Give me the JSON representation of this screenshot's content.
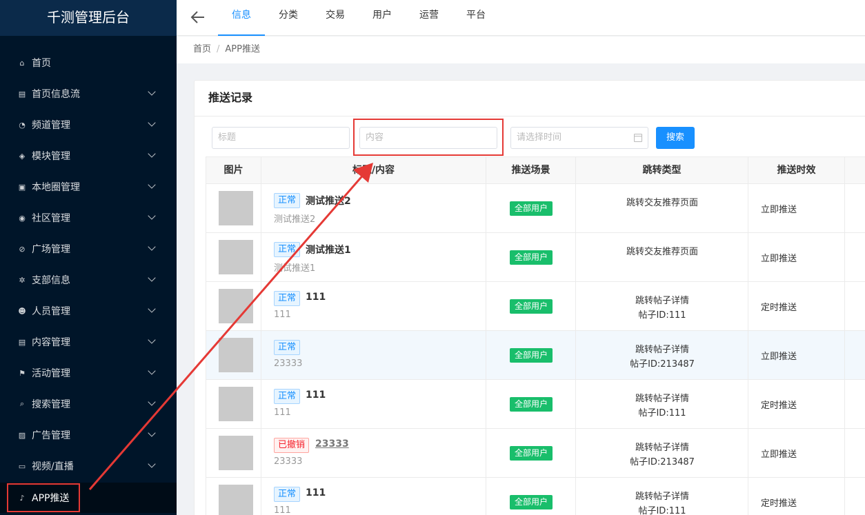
{
  "app": {
    "title": "千测管理后台"
  },
  "sidebar": {
    "items": [
      {
        "label": "首页",
        "icon": "home-icon",
        "glyph": "⌂",
        "has_arrow": false
      },
      {
        "label": "首页信息流",
        "icon": "list-icon",
        "glyph": "▤",
        "has_arrow": true
      },
      {
        "label": "频道管理",
        "icon": "rss-icon",
        "glyph": "◔",
        "has_arrow": true
      },
      {
        "label": "模块管理",
        "icon": "cube-icon",
        "glyph": "◈",
        "has_arrow": true
      },
      {
        "label": "本地圈管理",
        "icon": "location-icon",
        "glyph": "▣",
        "has_arrow": true
      },
      {
        "label": "社区管理",
        "icon": "community-icon",
        "glyph": "◉",
        "has_arrow": true
      },
      {
        "label": "广场管理",
        "icon": "compass-icon",
        "glyph": "⊘",
        "has_arrow": true
      },
      {
        "label": "支部信息",
        "icon": "settings-icon",
        "glyph": "✲",
        "has_arrow": true
      },
      {
        "label": "人员管理",
        "icon": "users-icon",
        "glyph": "☻",
        "has_arrow": true
      },
      {
        "label": "内容管理",
        "icon": "document-icon",
        "glyph": "▤",
        "has_arrow": true
      },
      {
        "label": "活动管理",
        "icon": "flag-icon",
        "glyph": "⚑",
        "has_arrow": true
      },
      {
        "label": "搜索管理",
        "icon": "search-icon",
        "glyph": "⌕",
        "has_arrow": true
      },
      {
        "label": "广告管理",
        "icon": "image-icon",
        "glyph": "▨",
        "has_arrow": true
      },
      {
        "label": "视频/直播",
        "icon": "video-icon",
        "glyph": "▭",
        "has_arrow": true
      },
      {
        "label": "APP推送",
        "icon": "bell-icon",
        "glyph": "♪",
        "has_arrow": false,
        "active": true
      }
    ]
  },
  "header": {
    "tabs": [
      {
        "label": "信息",
        "active": true
      },
      {
        "label": "分类"
      },
      {
        "label": "交易"
      },
      {
        "label": "用户"
      },
      {
        "label": "运营"
      },
      {
        "label": "平台"
      }
    ]
  },
  "breadcrumb": {
    "home": "首页",
    "current": "APP推送"
  },
  "card": {
    "title": "推送记录"
  },
  "filters": {
    "title_placeholder": "标题",
    "content_placeholder": "内容",
    "date_placeholder": "请选择时间",
    "search_label": "搜索"
  },
  "table": {
    "columns": [
      "图片",
      "标题/内容",
      "推送场景",
      "跳转类型",
      "推送时效"
    ],
    "rows": [
      {
        "status": "正常",
        "status_type": "ok",
        "title": "测试推送2",
        "content": "测试推送2",
        "scene": "全部用户",
        "jump": "跳转交友推荐页面",
        "jump_detail": "",
        "effect": "立即推送"
      },
      {
        "status": "正常",
        "status_type": "ok",
        "title": "测试推送1",
        "content": "测试推送1",
        "scene": "全部用户",
        "jump": "跳转交友推荐页面",
        "jump_detail": "",
        "effect": "立即推送"
      },
      {
        "status": "正常",
        "status_type": "ok",
        "title": "111",
        "content": "111",
        "scene": "全部用户",
        "jump": "跳转帖子详情",
        "jump_detail": "帖子ID:111",
        "effect": "定时推送"
      },
      {
        "status": "正常",
        "status_type": "ok",
        "title": "",
        "content": "23333",
        "scene": "全部用户",
        "jump": "跳转帖子详情",
        "jump_detail": "帖子ID:213487",
        "effect": "立即推送",
        "highlight": true
      },
      {
        "status": "正常",
        "status_type": "ok",
        "title": "111",
        "content": "111",
        "scene": "全部用户",
        "jump": "跳转帖子详情",
        "jump_detail": "帖子ID:111",
        "effect": "定时推送"
      },
      {
        "status": "已撤销",
        "status_type": "no",
        "title": "23333",
        "content": "23333",
        "scene": "全部用户",
        "jump": "跳转帖子详情",
        "jump_detail": "帖子ID:213487",
        "effect": "立即推送",
        "link": true
      },
      {
        "status": "正常",
        "status_type": "ok",
        "title": "111",
        "content": "111",
        "scene": "全部用户",
        "jump": "跳转帖子详情",
        "jump_detail": "帖子ID:111",
        "effect": "定时推送"
      }
    ]
  },
  "colors": {
    "sidebar_bg": "#001529",
    "accent": "#1890ff",
    "scene_green": "#19be6b",
    "annotation_red": "#e53935"
  }
}
